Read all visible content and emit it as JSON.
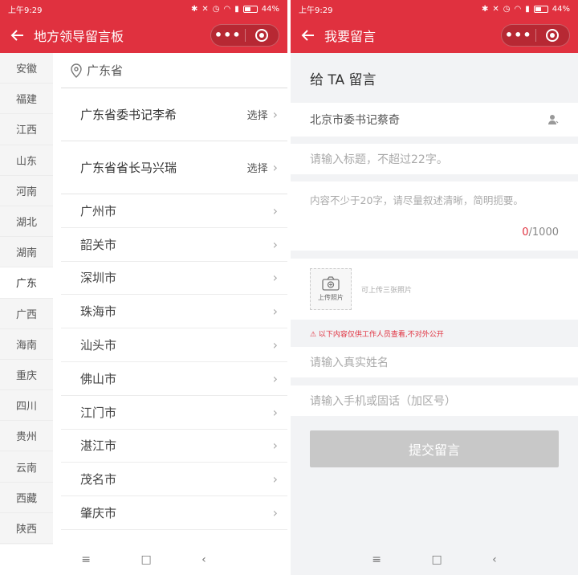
{
  "status": {
    "time": "上午9:29",
    "battery": "44%"
  },
  "left": {
    "title": "地方领导留言板",
    "provinces": [
      "安徽",
      "福建",
      "江西",
      "山东",
      "河南",
      "湖北",
      "湖南",
      "广东",
      "广西",
      "海南",
      "重庆",
      "四川",
      "贵州",
      "云南",
      "西藏",
      "陕西"
    ],
    "active_province": "广东",
    "location": "广东省",
    "leaders": [
      {
        "name": "广东省委书记李希",
        "action": "选择"
      },
      {
        "name": "广东省省长马兴瑞",
        "action": "选择"
      }
    ],
    "cities": [
      "广州市",
      "韶关市",
      "深圳市",
      "珠海市",
      "汕头市",
      "佛山市",
      "江门市",
      "湛江市",
      "茂名市",
      "肇庆市"
    ]
  },
  "right": {
    "title": "我要留言",
    "heading": "给 TA 留言",
    "recipient": "北京市委书记蔡奇",
    "title_placeholder": "请输入标题，不超过22字。",
    "content_placeholder": "内容不少于20字，请尽量叙述清晰，简明扼要。",
    "count_current": "0",
    "count_max": "/1000",
    "upload_label": "上传照片",
    "upload_hint": "可上传三张照片",
    "notice": "⚠ 以下内容仅供工作人员查看,不对外公开",
    "name_placeholder": "请输入真实姓名",
    "phone_placeholder": "请输入手机或固话（加区号）",
    "submit_label": "提交留言"
  },
  "nav": {
    "menu": "≡",
    "home": "□",
    "back": "‹"
  },
  "colors": {
    "accent": "#e0313f",
    "submit_disabled": "#c8c8c8"
  }
}
